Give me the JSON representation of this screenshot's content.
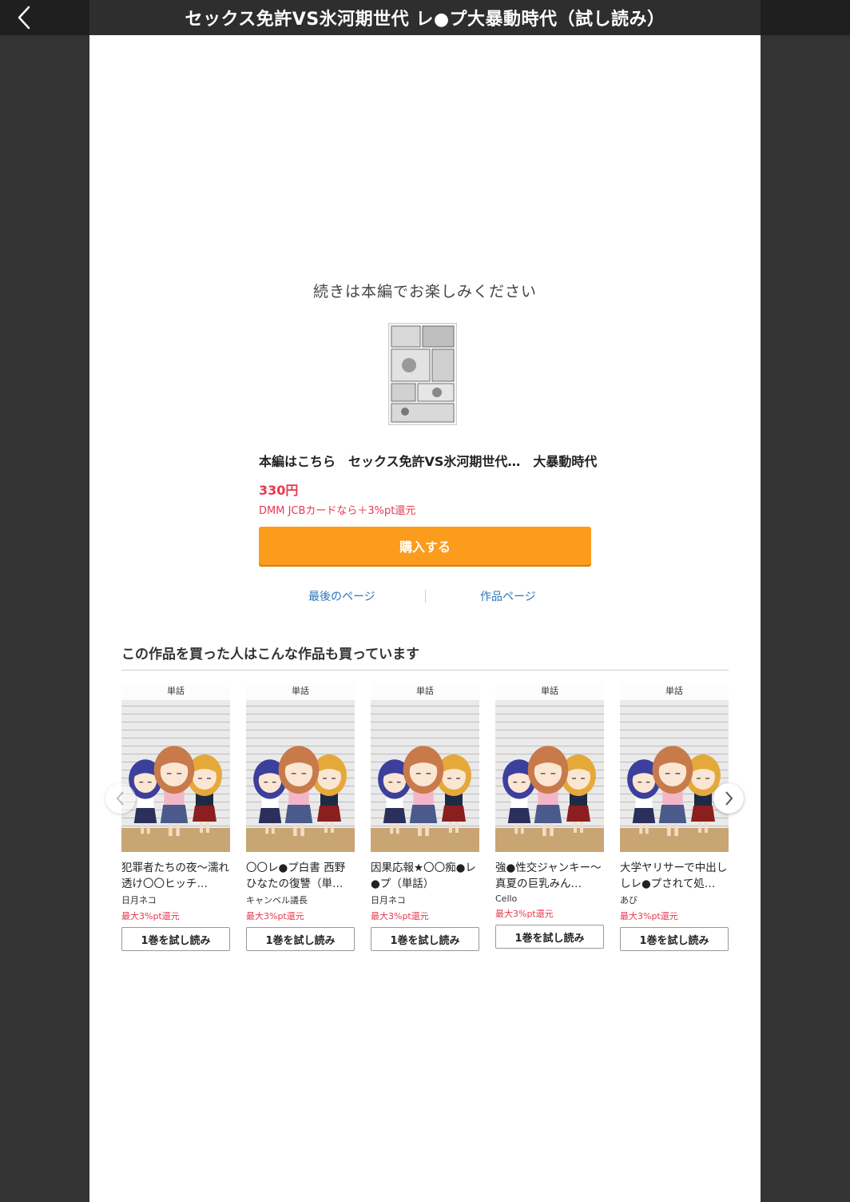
{
  "header": {
    "title": "セックス免許VS氷河期世代 レ●プ大暴動時代（試し読み）",
    "back_icon": "chevron-left-icon"
  },
  "end_message": "続きは本編でお楽しみください",
  "product": {
    "title": "本編はこちら　セックス免許VS氷河期世代…　大暴動時代",
    "price": "330円",
    "point_note": "DMM JCBカードなら＋3%pt還元",
    "buy_label": "購入する"
  },
  "links": {
    "last_page": "最後のページ",
    "work_page": "作品ページ"
  },
  "recommend": {
    "heading": "この作品を買った人はこんな作品も買っています",
    "items": [
      {
        "badge": "単話",
        "title": "犯罪者たちの夜〜濡れ透け〇〇ヒッチ…",
        "author": "日月ネコ",
        "point": "最大3%pt還元",
        "button": "1巻を試し読み"
      },
      {
        "badge": "単話",
        "title": "〇〇レ●プ白書 西野ひなたの復讐（単…",
        "author": "キャンベル議長",
        "point": "最大3%pt還元",
        "button": "1巻を試し読み"
      },
      {
        "badge": "単話",
        "title": "因果応報★〇〇痴●レ●プ（単話）",
        "author": "日月ネコ",
        "point": "最大3%pt還元",
        "button": "1巻を試し読み"
      },
      {
        "badge": "単話",
        "title": "強●性交ジャンキー〜真夏の巨乳みん…",
        "author": "Cello",
        "point": "最大3%pt還元",
        "button": "1巻を試し読み"
      },
      {
        "badge": "単話",
        "title": "大学ヤリサーで中出ししレ●プされて処…",
        "author": "あび",
        "point": "最大3%pt還元",
        "button": "1巻を試し読み"
      }
    ],
    "prev_icon": "chevron-left-icon",
    "next_icon": "chevron-right-icon"
  },
  "colors": {
    "accent_orange": "#fb9c1c",
    "price_red": "#e8384f",
    "link_blue": "#2a76b8"
  }
}
